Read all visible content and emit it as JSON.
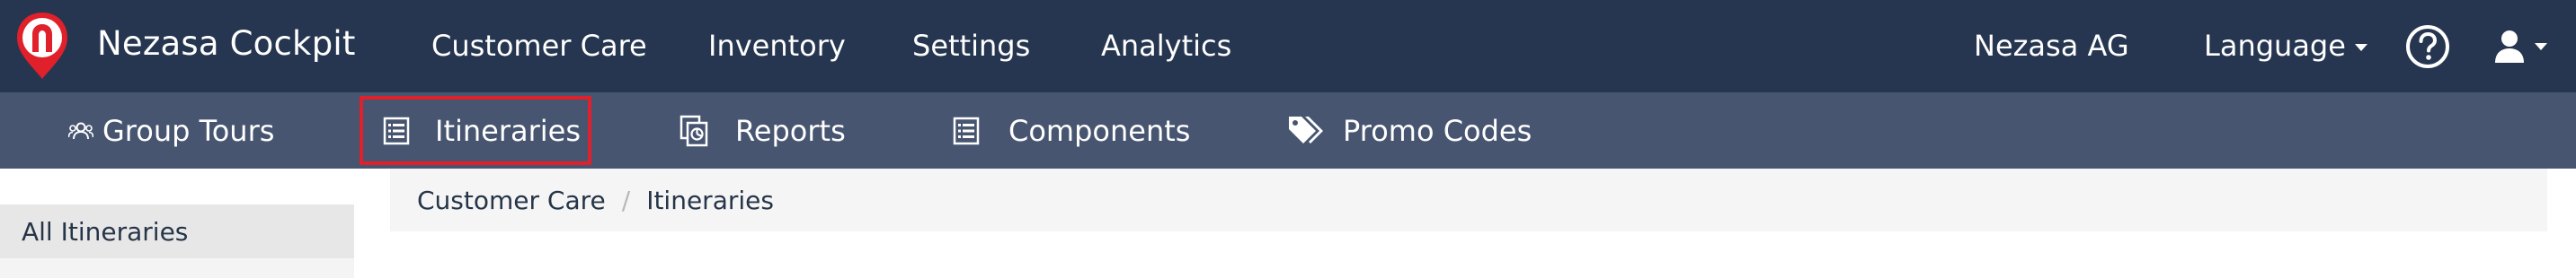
{
  "brand": {
    "name": "Nezasa Cockpit",
    "logo_color": "#e0202a"
  },
  "top_nav": {
    "items": [
      {
        "label": "Customer Care"
      },
      {
        "label": "Inventory"
      },
      {
        "label": "Settings"
      },
      {
        "label": "Analytics"
      }
    ],
    "org": "Nezasa AG",
    "language": "Language",
    "help_icon": "question-circle-icon",
    "user_icon": "user-icon"
  },
  "sub_nav": {
    "items": [
      {
        "label": "Group Tours",
        "icon": "users-icon"
      },
      {
        "label": "Itineraries",
        "icon": "list-icon",
        "highlighted": true
      },
      {
        "label": "Reports",
        "icon": "reports-icon"
      },
      {
        "label": "Components",
        "icon": "list-icon"
      },
      {
        "label": "Promo Codes",
        "icon": "tags-icon"
      }
    ],
    "highlight_color": "#e0202a"
  },
  "sidebar": {
    "items": [
      {
        "label": "All Itineraries"
      }
    ]
  },
  "breadcrumb": {
    "items": [
      "Customer Care",
      "Itineraries"
    ],
    "separator": "/"
  },
  "colors": {
    "topbar": "#263650",
    "subbar": "#475570"
  }
}
